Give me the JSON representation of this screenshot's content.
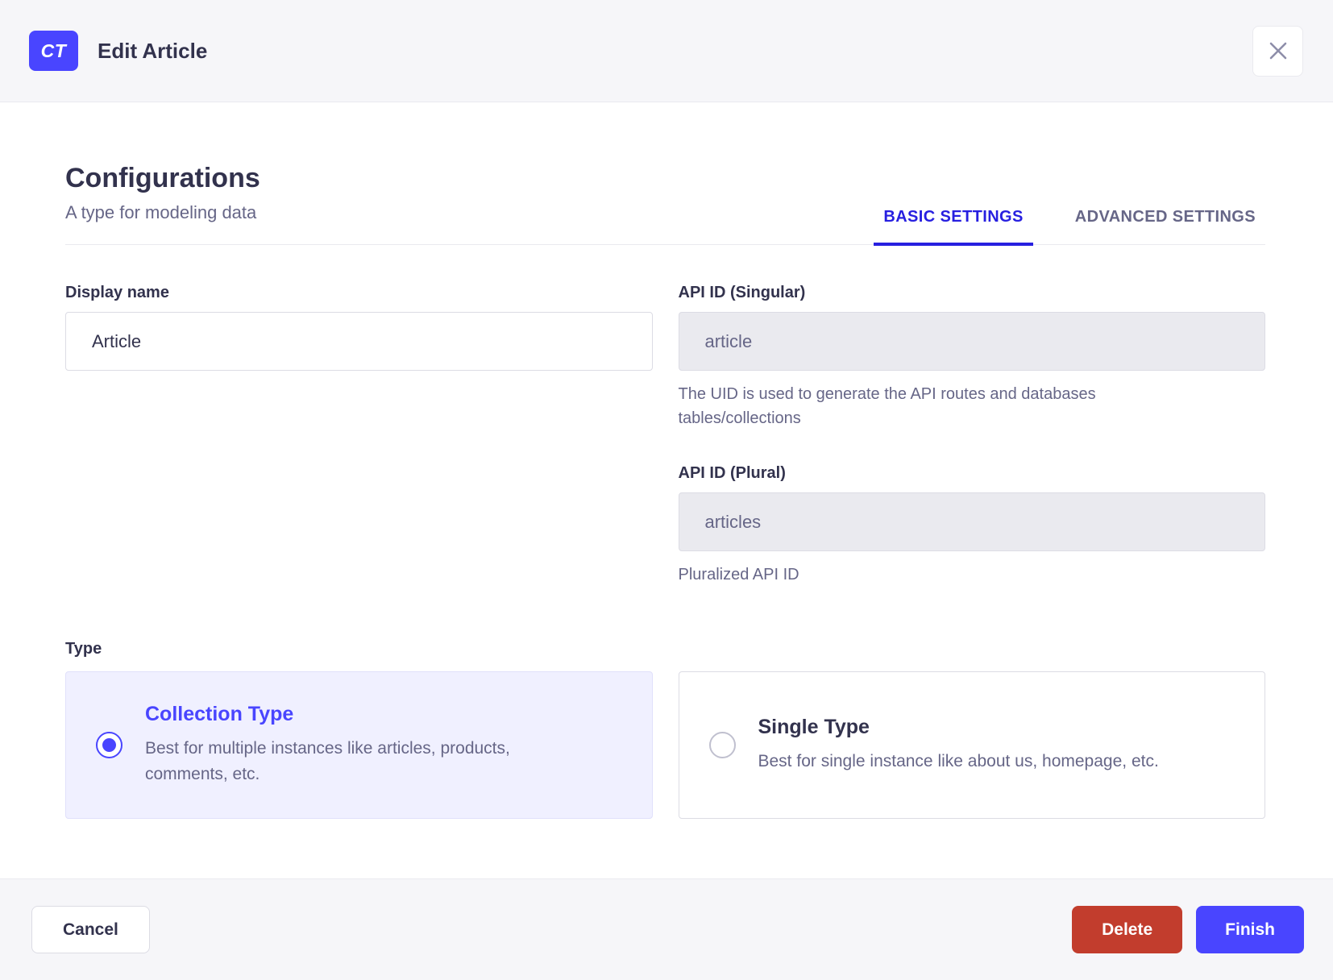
{
  "header": {
    "badge": "CT",
    "title": "Edit Article",
    "close_icon": "x-icon"
  },
  "section": {
    "title": "Configurations",
    "subtitle": "A type for modeling data"
  },
  "tabs": [
    {
      "label": "BASIC SETTINGS",
      "active": true
    },
    {
      "label": "ADVANCED SETTINGS",
      "active": false
    }
  ],
  "fields": {
    "display_name": {
      "label": "Display name",
      "value": "Article"
    },
    "api_id_singular": {
      "label": "API ID (Singular)",
      "value": "article",
      "hint": "The UID is used to generate the API routes and databases tables/collections"
    },
    "api_id_plural": {
      "label": "API ID (Plural)",
      "value": "articles",
      "hint": "Pluralized API ID"
    }
  },
  "type_section": {
    "label": "Type",
    "options": [
      {
        "title": "Collection Type",
        "description": "Best for multiple instances like articles, products, comments, etc.",
        "selected": true
      },
      {
        "title": "Single Type",
        "description": "Best for single instance like about us, homepage, etc.",
        "selected": false
      }
    ]
  },
  "footer": {
    "cancel_label": "Cancel",
    "delete_label": "Delete",
    "finish_label": "Finish"
  },
  "colors": {
    "primary": "#4945ff",
    "active_tab": "#271fe0",
    "danger": "#c23d2d",
    "header_bg": "#f6f6f9",
    "selected_card_bg": "#f0f0ff",
    "disabled_input_bg": "#eaeaef",
    "muted_text": "#666687",
    "dark_text": "#32324d"
  }
}
